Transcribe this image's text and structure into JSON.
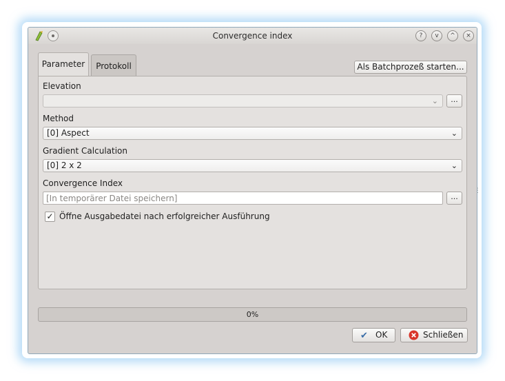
{
  "window": {
    "title": "Convergence index",
    "buttons": [
      "?",
      "v",
      "^",
      "×"
    ]
  },
  "tabs": [
    {
      "label": "Parameter",
      "active": true
    },
    {
      "label": "Protokoll",
      "active": false
    }
  ],
  "batch_button": "Als Batchprozeß starten...",
  "form": {
    "elevation": {
      "label": "Elevation",
      "value": "",
      "browse": "..."
    },
    "method": {
      "label": "Method",
      "value": "[0] Aspect"
    },
    "gradient": {
      "label": "Gradient Calculation",
      "value": "[0] 2 x 2"
    },
    "convergence": {
      "label": "Convergence Index",
      "placeholder": "[In temporärer Datei speichern]",
      "browse": "..."
    },
    "open_output": {
      "label": "Öffne Ausgabedatei nach erfolgreicher Ausführung",
      "checked": true
    }
  },
  "progress": {
    "text": "0%",
    "value": 0
  },
  "footer": {
    "ok_label": "OK",
    "close_label": "Schließen"
  },
  "icons": {
    "app": "qgis-icon",
    "ok": "check-icon",
    "close": "close-circle-icon"
  },
  "colors": {
    "window_bg": "#d6d2d0",
    "panel_bg": "#e4e1df",
    "close_icon": "#d9362b",
    "ok_icon": "#3a6ea8"
  }
}
